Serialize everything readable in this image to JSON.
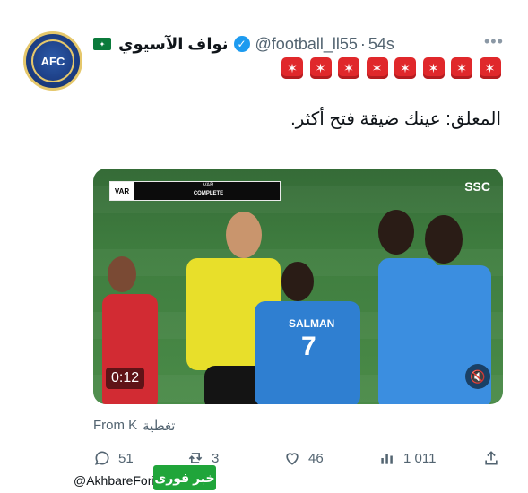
{
  "header": {
    "display_name": "نواف الآسيوي",
    "handle": "@football_ll55",
    "separator": "·",
    "time": "54s",
    "verified": true,
    "flag_icon": "saudi-flag-icon",
    "avatar_text": "AFC"
  },
  "emoji_row": {
    "count": 8,
    "icon": "red-star-emoji",
    "color": "#e0282b"
  },
  "tweet": {
    "text": "المعلق: عينك ضيقة فتح أكثر."
  },
  "media": {
    "var_badge": "VAR",
    "var_title": "VAR",
    "var_status": "COMPLETE",
    "broadcaster": "SSC",
    "timer": "0:12",
    "mute_icon": "mute-icon",
    "player_name": "SALMAN",
    "player_number": "7"
  },
  "from_line": {
    "label": "From K",
    "source": "تغطية"
  },
  "actions": {
    "replies": "51",
    "reposts": "3",
    "likes": "46",
    "views": "1 011"
  },
  "watermark": {
    "handle": "@AkhbareFori",
    "logo": "خبر فوری"
  }
}
